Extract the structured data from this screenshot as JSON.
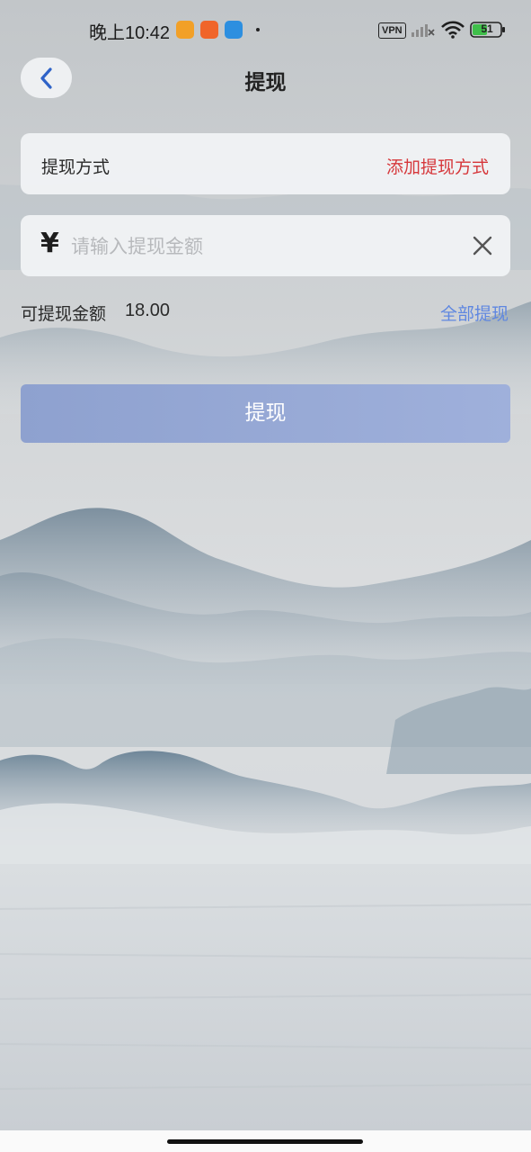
{
  "status_bar": {
    "time": "晚上10:42",
    "vpn_label": "VPN",
    "battery_level": "51",
    "app_icons": [
      "bird-app-icon",
      "video-app-icon",
      "cube-app-icon"
    ]
  },
  "header": {
    "back_icon": "chevron-left-icon",
    "title": "提现"
  },
  "method_row": {
    "label": "提现方式",
    "add_label": "添加提现方式"
  },
  "amount_field": {
    "currency_symbol": "¥",
    "placeholder": "请输入提现金额",
    "value": "",
    "clear_icon": "close-icon"
  },
  "available": {
    "label": "可提现金额",
    "value": "18.00",
    "withdraw_all_label": "全部提现"
  },
  "submit": {
    "label": "提现"
  },
  "colors": {
    "accent_red": "#d6373b",
    "link_blue": "#5f87e0",
    "button_blue": "#95a8d5"
  }
}
